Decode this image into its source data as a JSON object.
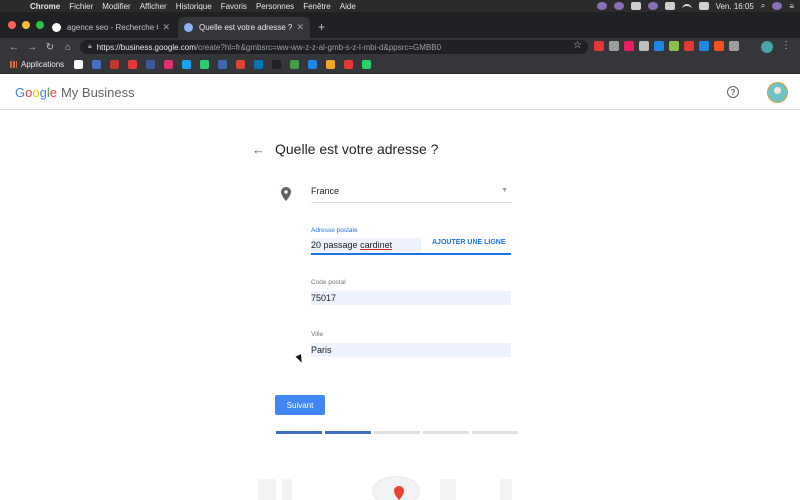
{
  "menubar": {
    "app": "Chrome",
    "items": [
      "Fichier",
      "Modifier",
      "Afficher",
      "Historique",
      "Favoris",
      "Personnes",
      "Fenêtre",
      "Aide"
    ],
    "clock": "Ven. 16:05"
  },
  "tabs": [
    {
      "title": "agence seo - Recherche Google",
      "favicon_color": "#ffffff",
      "close": "✕"
    },
    {
      "title": "Quelle est votre adresse ? | Go",
      "favicon_color": "#8ab4f8",
      "close": "✕"
    }
  ],
  "new_tab": "+",
  "toolbar": {
    "url_host": "https://business.google.com",
    "url_path": "/create?hl=fr&gmbsrc=ww-ww-z-z-al-gmb-s-z-l-mbi-d&ppsrc=GMBB0"
  },
  "bookmarks": {
    "apps_label": "Applications",
    "icon_colors": [
      "#ffffff",
      "#4a6fc0",
      "#c0392b",
      "#e53935",
      "#3b5998",
      "#e1306c",
      "#1da1f2",
      "#2ecc71",
      "#4267b2",
      "#db4437",
      "#0077b5",
      "#222222",
      "#43a047",
      "#1e88e5",
      "#f4a62a",
      "#e53935",
      "#25d366"
    ]
  },
  "header": {
    "logo_letters": [
      {
        "ch": "G",
        "color": "#4285f4"
      },
      {
        "ch": "o",
        "color": "#ea4335"
      },
      {
        "ch": "o",
        "color": "#fbbc05"
      },
      {
        "ch": "g",
        "color": "#4285f4"
      },
      {
        "ch": "l",
        "color": "#34a853"
      },
      {
        "ch": "e",
        "color": "#ea4335"
      }
    ],
    "product": "My Business",
    "help": "?"
  },
  "form": {
    "back": "←",
    "title": "Quelle est votre adresse ?",
    "country": "France",
    "address_label": "Adresse postale",
    "address_value": "20 passage",
    "address_value_underlined": "cardinet",
    "add_line": "AJOUTER UNE LIGNE",
    "postal_label": "Code postal",
    "postal_value": "75017",
    "city_label": "Ville",
    "city_value": "Paris",
    "next": "Suivant",
    "progress": {
      "steps": 5,
      "completed": 2
    }
  },
  "colors": {
    "accent": "#1a73e8",
    "button": "#4285f4",
    "progress_done": "#3f6ec4",
    "field_bg": "#edf2fc",
    "pin": "#5f6368",
    "map_pin": "#ea4335"
  }
}
